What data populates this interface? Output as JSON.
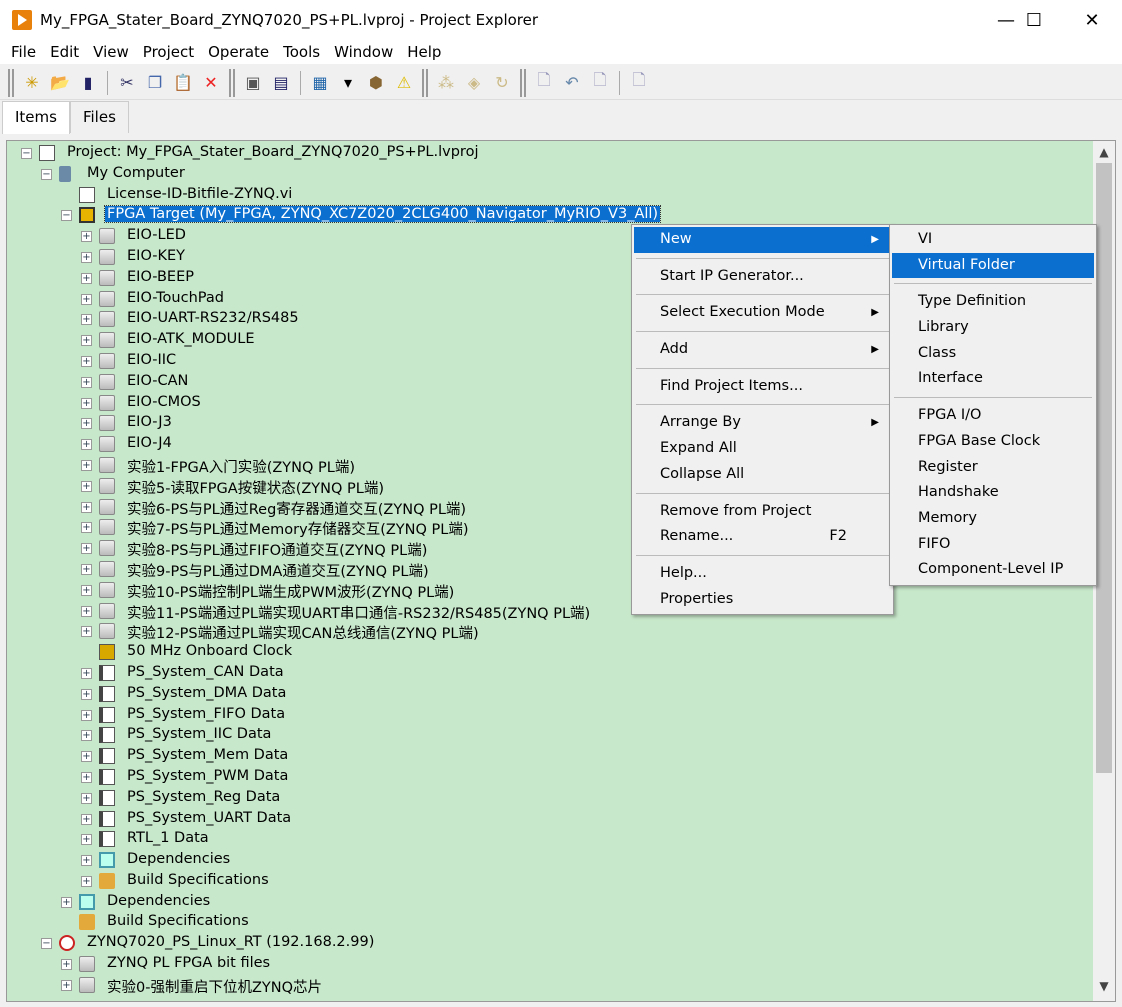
{
  "window": {
    "title": "My_FPGA_Stater_Board_ZYNQ7020_PS+PL.lvproj - Project Explorer",
    "minimize": "—",
    "maximize": "☐",
    "close": "✕"
  },
  "menubar": [
    "File",
    "Edit",
    "View",
    "Project",
    "Operate",
    "Tools",
    "Window",
    "Help"
  ],
  "toolbar": [
    {
      "icon": "new-icon",
      "glyph": "✳",
      "color": "#c90"
    },
    {
      "icon": "open-icon",
      "glyph": "📂",
      "color": "#c90"
    },
    {
      "icon": "save-all-icon",
      "glyph": "▮",
      "color": "#226"
    },
    {
      "sep": true
    },
    {
      "icon": "cut-icon",
      "glyph": "✂",
      "color": "#336"
    },
    {
      "icon": "copy-icon",
      "glyph": "❐",
      "color": "#46a"
    },
    {
      "icon": "paste-icon",
      "glyph": "📋",
      "color": "#bbb"
    },
    {
      "icon": "delete-icon",
      "glyph": "✕",
      "color": "#e22"
    },
    {
      "grip": true
    },
    {
      "icon": "build-icon",
      "glyph": "▣",
      "color": "#555"
    },
    {
      "icon": "save-target-icon",
      "glyph": "▤",
      "color": "#226"
    },
    {
      "sep": true
    },
    {
      "icon": "view-icon",
      "glyph": "▦",
      "color": "#26a"
    },
    {
      "icon": "dropdown-icon",
      "glyph": "▾",
      "color": "#000"
    },
    {
      "icon": "deploy-icon",
      "glyph": "⬢",
      "color": "#863"
    },
    {
      "icon": "warning-icon",
      "glyph": "⚠",
      "color": "#db0"
    },
    {
      "grip": true
    },
    {
      "icon": "resolve-icon",
      "glyph": "⁂",
      "color": "#cb8"
    },
    {
      "icon": "package-icon",
      "glyph": "◈",
      "color": "#cb8"
    },
    {
      "icon": "refresh-icon",
      "glyph": "↻",
      "color": "#cb8"
    },
    {
      "grip": true
    },
    {
      "icon": "check-icon",
      "glyph": "🗋",
      "color": "#99b"
    },
    {
      "icon": "undo-icon",
      "glyph": "↶",
      "color": "#68a"
    },
    {
      "icon": "add-file-icon",
      "glyph": "🗋",
      "color": "#99b"
    },
    {
      "sep": true
    },
    {
      "icon": "add-item-icon",
      "glyph": "🗋",
      "color": "#99b"
    }
  ],
  "tabs": [
    "Items",
    "Files"
  ],
  "tree": [
    {
      "level": 0,
      "exp": "-",
      "icon": "vi",
      "label": "Project: My_FPGA_Stater_Board_ZYNQ7020_PS+PL.lvproj"
    },
    {
      "level": 1,
      "exp": "-",
      "icon": "pc",
      "label": "My Computer"
    },
    {
      "level": 2,
      "exp": "",
      "icon": "vi",
      "label": "License-ID-Bitfile-ZYNQ.vi"
    },
    {
      "level": 2,
      "exp": "-",
      "icon": "fpga",
      "label": "FPGA Target (My_FPGA, ZYNQ_XC7Z020_2CLG400_Navigator_MyRIO_V3_All)",
      "selected": true
    },
    {
      "level": 3,
      "exp": "+",
      "icon": "folder",
      "label": "EIO-LED"
    },
    {
      "level": 3,
      "exp": "+",
      "icon": "folder",
      "label": "EIO-KEY"
    },
    {
      "level": 3,
      "exp": "+",
      "icon": "folder",
      "label": "EIO-BEEP"
    },
    {
      "level": 3,
      "exp": "+",
      "icon": "folder",
      "label": "EIO-TouchPad"
    },
    {
      "level": 3,
      "exp": "+",
      "icon": "folder",
      "label": "EIO-UART-RS232/RS485"
    },
    {
      "level": 3,
      "exp": "+",
      "icon": "folder",
      "label": "EIO-ATK_MODULE"
    },
    {
      "level": 3,
      "exp": "+",
      "icon": "folder",
      "label": "EIO-IIC"
    },
    {
      "level": 3,
      "exp": "+",
      "icon": "folder",
      "label": "EIO-CAN"
    },
    {
      "level": 3,
      "exp": "+",
      "icon": "folder",
      "label": "EIO-CMOS"
    },
    {
      "level": 3,
      "exp": "+",
      "icon": "folder",
      "label": "EIO-J3"
    },
    {
      "level": 3,
      "exp": "+",
      "icon": "folder",
      "label": "EIO-J4"
    },
    {
      "level": 3,
      "exp": "+",
      "icon": "folder",
      "label": "实验1-FPGA入门实验(ZYNQ PL端)"
    },
    {
      "level": 3,
      "exp": "+",
      "icon": "folder",
      "label": "实验5-读取FPGA按键状态(ZYNQ PL端)"
    },
    {
      "level": 3,
      "exp": "+",
      "icon": "folder",
      "label": "实验6-PS与PL通过Reg寄存器通道交互(ZYNQ PL端)"
    },
    {
      "level": 3,
      "exp": "+",
      "icon": "folder",
      "label": "实验7-PS与PL通过Memory存储器交互(ZYNQ PL端)"
    },
    {
      "level": 3,
      "exp": "+",
      "icon": "folder",
      "label": "实验8-PS与PL通过FIFO通道交互(ZYNQ PL端)"
    },
    {
      "level": 3,
      "exp": "+",
      "icon": "folder",
      "label": "实验9-PS与PL通过DMA通道交互(ZYNQ PL端)"
    },
    {
      "level": 3,
      "exp": "+",
      "icon": "folder",
      "label": "实验10-PS端控制PL端生成PWM波形(ZYNQ PL端)"
    },
    {
      "level": 3,
      "exp": "+",
      "icon": "folder",
      "label": "实验11-PS端通过PL端实现UART串口通信-RS232/RS485(ZYNQ PL端)"
    },
    {
      "level": 3,
      "exp": "+",
      "icon": "folder",
      "label": "实验12-PS端通过PL端实现CAN总线通信(ZYNQ PL端)"
    },
    {
      "level": 3,
      "exp": "",
      "icon": "clock",
      "label": "50 MHz Onboard Clock"
    },
    {
      "level": 3,
      "exp": "+",
      "icon": "data",
      "label": "PS_System_CAN Data"
    },
    {
      "level": 3,
      "exp": "+",
      "icon": "data",
      "label": "PS_System_DMA Data"
    },
    {
      "level": 3,
      "exp": "+",
      "icon": "data",
      "label": "PS_System_FIFO Data"
    },
    {
      "level": 3,
      "exp": "+",
      "icon": "data",
      "label": "PS_System_IIC Data"
    },
    {
      "level": 3,
      "exp": "+",
      "icon": "data",
      "label": "PS_System_Mem Data"
    },
    {
      "level": 3,
      "exp": "+",
      "icon": "data",
      "label": "PS_System_PWM Data"
    },
    {
      "level": 3,
      "exp": "+",
      "icon": "data",
      "label": "PS_System_Reg Data"
    },
    {
      "level": 3,
      "exp": "+",
      "icon": "data",
      "label": "PS_System_UART Data"
    },
    {
      "level": 3,
      "exp": "+",
      "icon": "data",
      "label": "RTL_1 Data"
    },
    {
      "level": 3,
      "exp": "+",
      "icon": "deps",
      "label": "Dependencies"
    },
    {
      "level": 3,
      "exp": "+",
      "icon": "build",
      "label": "Build Specifications"
    },
    {
      "level": 2,
      "exp": "+",
      "icon": "deps",
      "label": "Dependencies"
    },
    {
      "level": 2,
      "exp": "",
      "icon": "build",
      "label": "Build Specifications"
    },
    {
      "level": 1,
      "exp": "-",
      "icon": "rt",
      "label": "ZYNQ7020_PS_Linux_RT (192.168.2.99)"
    },
    {
      "level": 2,
      "exp": "+",
      "icon": "folder",
      "label": "ZYNQ PL FPGA bit files"
    },
    {
      "level": 2,
      "exp": "+",
      "icon": "folder",
      "label": "实验0-强制重启下位机ZYNQ芯片"
    }
  ],
  "context_menu": [
    {
      "label": "New",
      "sub": true,
      "highlight": true
    },
    {
      "sep": true
    },
    {
      "label": "Start IP Generator..."
    },
    {
      "sep": true
    },
    {
      "label": "Select Execution Mode",
      "sub": true
    },
    {
      "sep": true
    },
    {
      "label": "Add",
      "sub": true
    },
    {
      "sep": true
    },
    {
      "label": "Find Project Items..."
    },
    {
      "sep": true
    },
    {
      "label": "Arrange By",
      "sub": true
    },
    {
      "label": "Expand All"
    },
    {
      "label": "Collapse All"
    },
    {
      "sep": true
    },
    {
      "label": "Remove from Project"
    },
    {
      "label": "Rename...",
      "key": "F2"
    },
    {
      "sep": true
    },
    {
      "label": "Help..."
    },
    {
      "label": "Properties"
    }
  ],
  "submenu": [
    {
      "label": "VI"
    },
    {
      "label": "Virtual Folder",
      "highlight": true
    },
    {
      "sep": true
    },
    {
      "label": "Type Definition"
    },
    {
      "label": "Library"
    },
    {
      "label": "Class"
    },
    {
      "label": "Interface"
    },
    {
      "sep": true
    },
    {
      "label": "FPGA I/O"
    },
    {
      "label": "FPGA Base Clock"
    },
    {
      "label": "Register"
    },
    {
      "label": "Handshake"
    },
    {
      "label": "Memory"
    },
    {
      "label": "FIFO"
    },
    {
      "label": "Component-Level IP"
    }
  ],
  "colors": {
    "tree_bg": "#c8e8cb",
    "selection": "#0b6fd0"
  }
}
